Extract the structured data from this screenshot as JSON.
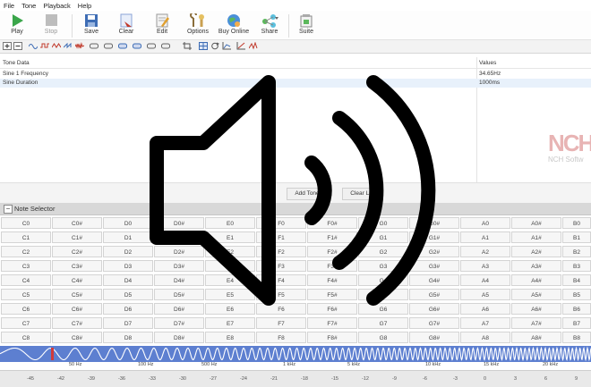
{
  "menu": [
    "File",
    "Tone",
    "Playback",
    "Help"
  ],
  "toolbar": {
    "play": "Play",
    "stop": "Stop",
    "save": "Save",
    "clear": "Clear",
    "edit": "Edit",
    "options": "Options",
    "buy_online": "Buy Online",
    "share": "Share",
    "suite": "Suite"
  },
  "grid": {
    "col_tone": "Tone Data",
    "col_values": "Values",
    "rows": [
      {
        "name": "Sine 1 Frequency",
        "value": "34.65Hz"
      },
      {
        "name": "Sine Duration",
        "value": "1000ms"
      }
    ]
  },
  "logo": {
    "mark": "NCH",
    "text": "NCH Softw"
  },
  "buttons": {
    "add_tone": "Add Tone",
    "clear_list": "Clear List"
  },
  "note_selector": {
    "title": "Note Selector",
    "rows": [
      [
        "C0",
        "C0#",
        "D0",
        "D0#",
        "E0",
        "F0",
        "F0#",
        "G0",
        "G0#",
        "A0",
        "A0#",
        "B0"
      ],
      [
        "C1",
        "C1#",
        "D1",
        "D1#",
        "E1",
        "F1",
        "F1#",
        "G1",
        "G1#",
        "A1",
        "A1#",
        "B1"
      ],
      [
        "C2",
        "C2#",
        "D2",
        "D2#",
        "E2",
        "F2",
        "F2#",
        "G2",
        "G2#",
        "A2",
        "A2#",
        "B2"
      ],
      [
        "C3",
        "C3#",
        "D3",
        "D3#",
        "E3",
        "F3",
        "F3#",
        "G3",
        "G3#",
        "A3",
        "A3#",
        "B3"
      ],
      [
        "C4",
        "C4#",
        "D4",
        "D4#",
        "E4",
        "F4",
        "F4#",
        "G4",
        "G4#",
        "A4",
        "A4#",
        "B4"
      ],
      [
        "C5",
        "C5#",
        "D5",
        "D5#",
        "E5",
        "F5",
        "F5#",
        "G5",
        "G5#",
        "A5",
        "A5#",
        "B5"
      ],
      [
        "C6",
        "C6#",
        "D6",
        "D6#",
        "E6",
        "F6",
        "F6#",
        "G6",
        "G6#",
        "A6",
        "A6#",
        "B6"
      ],
      [
        "C7",
        "C7#",
        "D7",
        "D7#",
        "E7",
        "F7",
        "F7#",
        "G7",
        "G7#",
        "A7",
        "A7#",
        "B7"
      ],
      [
        "C8",
        "C8#",
        "D8",
        "D8#",
        "E8",
        "F8",
        "F8#",
        "G8",
        "G8#",
        "A8",
        "A8#",
        "B8"
      ]
    ]
  },
  "frequency_labels": [
    "50 Hz",
    "100 Hz",
    "500 Hz",
    "1 kHz",
    "5 kHz",
    "10 kHz",
    "15 kHz",
    "20 kHz"
  ],
  "ruler_labels": [
    "-45",
    "-42",
    "-39",
    "-36",
    "-33",
    "-30",
    "-27",
    "-24",
    "-21",
    "-18",
    "-15",
    "-12",
    "-9",
    "-6",
    "-3",
    "0",
    "3",
    "6",
    "9"
  ],
  "colors": {
    "accent_blue": "#5d7fd0",
    "play_green": "#3aa64a",
    "marker_red": "#d23a3a",
    "nch_red": "#d9534f"
  },
  "overlay_icon": "speaker-volume-icon"
}
